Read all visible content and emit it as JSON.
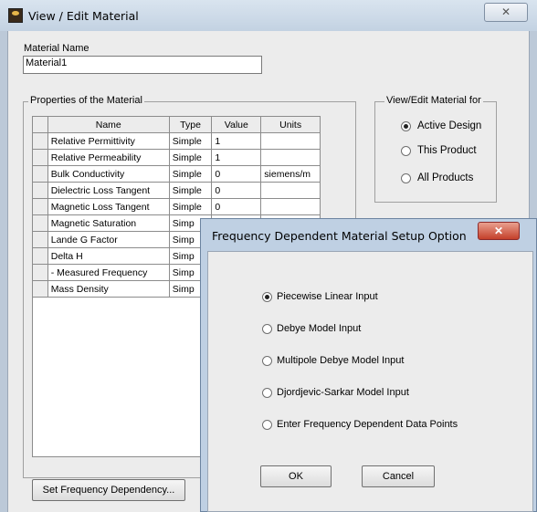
{
  "window": {
    "title": "View / Edit Material",
    "close_glyph": "✕"
  },
  "material_name": {
    "label": "Material Name",
    "value": "Material1"
  },
  "properties": {
    "group_title": "Properties of the Material",
    "columns": [
      "Name",
      "Type",
      "Value",
      "Units"
    ],
    "rows": [
      {
        "name": "Relative Permittivity",
        "type": "Simple",
        "value": "1",
        "units": ""
      },
      {
        "name": "Relative Permeability",
        "type": "Simple",
        "value": "1",
        "units": ""
      },
      {
        "name": "Bulk Conductivity",
        "type": "Simple",
        "value": "0",
        "units": "siemens/m"
      },
      {
        "name": "Dielectric Loss Tangent",
        "type": "Simple",
        "value": "0",
        "units": ""
      },
      {
        "name": "Magnetic Loss Tangent",
        "type": "Simple",
        "value": "0",
        "units": ""
      },
      {
        "name": "Magnetic Saturation",
        "type": "Simp",
        "value": "",
        "units": ""
      },
      {
        "name": "Lande G Factor",
        "type": "Simp",
        "value": "",
        "units": ""
      },
      {
        "name": "Delta H",
        "type": "Simp",
        "value": "",
        "units": ""
      },
      {
        "name": "- Measured Frequency",
        "type": "Simp",
        "value": "",
        "units": ""
      },
      {
        "name": "Mass Density",
        "type": "Simp",
        "value": "",
        "units": ""
      }
    ]
  },
  "view_edit_for": {
    "group_title": "View/Edit Material for",
    "options": [
      {
        "label": "Active Design",
        "checked": true
      },
      {
        "label": "This Product",
        "checked": false
      },
      {
        "label": "All Products",
        "checked": false
      }
    ]
  },
  "set_freq_button": "Set Frequency Dependency...",
  "dialog": {
    "title": "Frequency Dependent Material Setup Option",
    "close_glyph": "✕",
    "options": [
      {
        "label": "Piecewise Linear Input",
        "checked": true
      },
      {
        "label": "Debye Model Input",
        "checked": false
      },
      {
        "label": "Multipole Debye Model Input",
        "checked": false
      },
      {
        "label": "Djordjevic-Sarkar Model Input",
        "checked": false
      },
      {
        "label": "Enter Frequency Dependent Data Points",
        "checked": false
      }
    ],
    "ok_label": "OK",
    "cancel_label": "Cancel"
  }
}
